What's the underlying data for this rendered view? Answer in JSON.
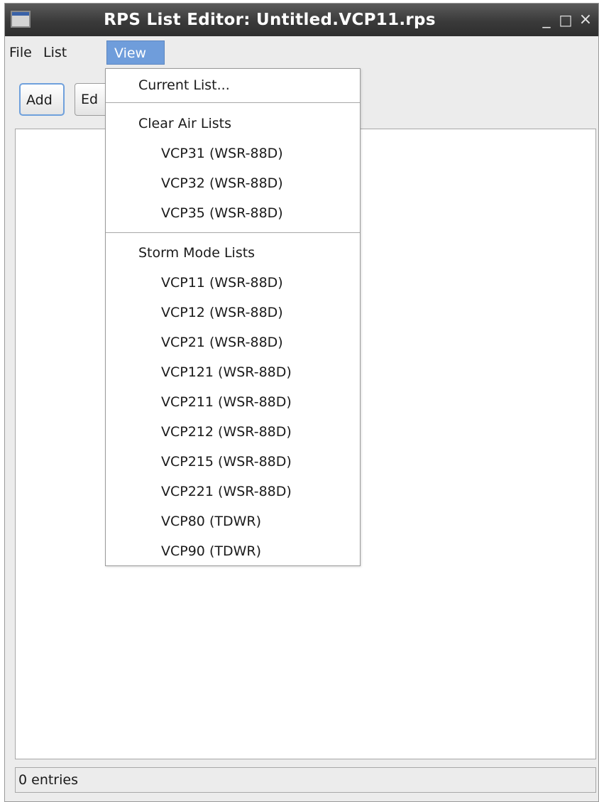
{
  "window": {
    "title": "RPS List Editor: Untitled.VCP11.rps",
    "controls": {
      "minimize": "_",
      "maximize": "□",
      "close": "×"
    }
  },
  "menubar": {
    "file": "File",
    "list": "List",
    "view": "View"
  },
  "toolbar": {
    "add_label": "Add",
    "edit_label": "Ed"
  },
  "status": {
    "text": "0 entries"
  },
  "view_menu": {
    "current_list": "Current List...",
    "clear_air": {
      "heading": "Clear Air Lists",
      "items": [
        "VCP31 (WSR-88D)",
        "VCP32 (WSR-88D)",
        "VCP35 (WSR-88D)"
      ]
    },
    "storm_mode": {
      "heading": "Storm Mode Lists",
      "items": [
        "VCP11 (WSR-88D)",
        "VCP12 (WSR-88D)",
        "VCP21 (WSR-88D)",
        "VCP121 (WSR-88D)",
        "VCP211 (WSR-88D)",
        "VCP212 (WSR-88D)",
        "VCP215 (WSR-88D)",
        "VCP221 (WSR-88D)",
        "VCP80 (TDWR)",
        "VCP90 (TDWR)"
      ]
    }
  },
  "colors": {
    "titlebar": "#3a3a3a",
    "menu_highlight": "#6f9ddb",
    "focus_border": "#6fa0dc"
  }
}
